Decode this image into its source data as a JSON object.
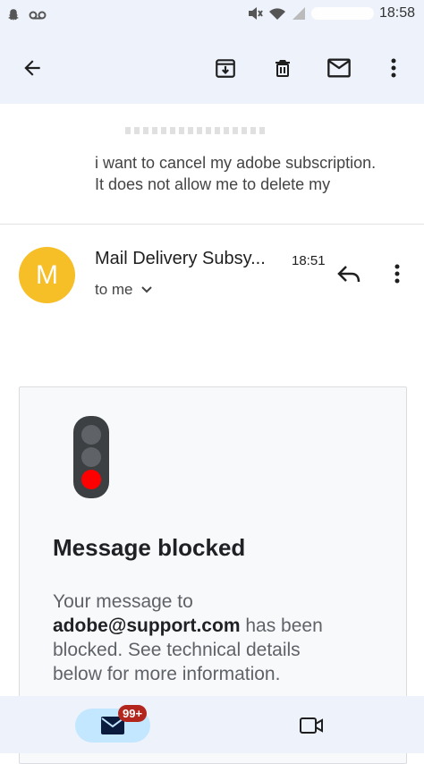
{
  "status_bar": {
    "time": "18:58"
  },
  "toolbar": {
    "back": "back",
    "archive": "archive",
    "delete": "delete",
    "mark_unread": "mark unread",
    "more": "more"
  },
  "previous_message": {
    "line1": "i want to cancel my adobe subscription.",
    "line2": "It does not allow me to delete my"
  },
  "message": {
    "avatar_letter": "M",
    "avatar_color": "#f6be27",
    "sender": "Mail Delivery Subsy...",
    "time": "18:51",
    "to_label": "to me"
  },
  "card": {
    "title": "Message blocked",
    "body_prefix": "Your message to",
    "body_email": "adobe@support.com",
    "body_suffix": " has been blocked. See technical details below for more information."
  },
  "bottom_nav": {
    "mail_badge": "99+"
  },
  "colors": {
    "badge": "#b3261e",
    "pill": "#c2e7ff",
    "red_lamp": "#ff0000"
  }
}
